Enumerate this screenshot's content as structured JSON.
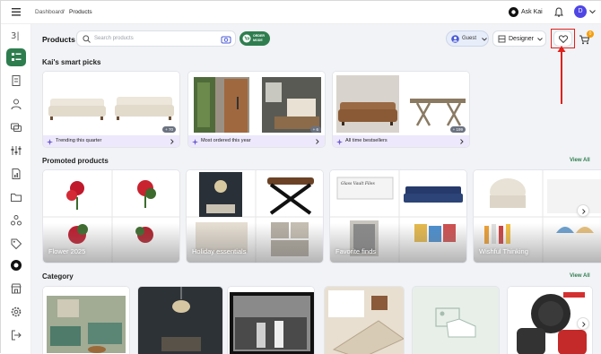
{
  "breadcrumb": {
    "root": "Dashboard",
    "separator": "/",
    "current": "Products"
  },
  "topbar": {
    "ask_label": "Ask Kai",
    "avatar_letter": "D"
  },
  "header": {
    "title": "Products",
    "search_placeholder": "Search products",
    "order_mode_line1": "ORDER",
    "order_mode_line2": "MODE",
    "guest_label": "Guest",
    "designer_label": "Designer",
    "cart_count": "0"
  },
  "smart_picks": {
    "title": "Kai's smart picks",
    "cards": [
      {
        "label": "Trending this quarter",
        "badge": "+ 70"
      },
      {
        "label": "Most ordered this year",
        "badge": "+ 6"
      },
      {
        "label": "All time bestsellers",
        "badge": "+ 199"
      }
    ]
  },
  "promoted": {
    "title": "Promoted products",
    "view_all": "View All",
    "cards": [
      {
        "label": "Flower 2025"
      },
      {
        "label": "Holiday essentials"
      },
      {
        "label": "Favorite finds",
        "inner_text": "Glass Vault Files"
      },
      {
        "label": "Wishful Thinking"
      }
    ]
  },
  "category": {
    "title": "Category",
    "view_all": "View All"
  },
  "colors": {
    "brand": "#2e7d4f",
    "highlight": "#e0201b",
    "accent_purple": "#ede8fb"
  }
}
